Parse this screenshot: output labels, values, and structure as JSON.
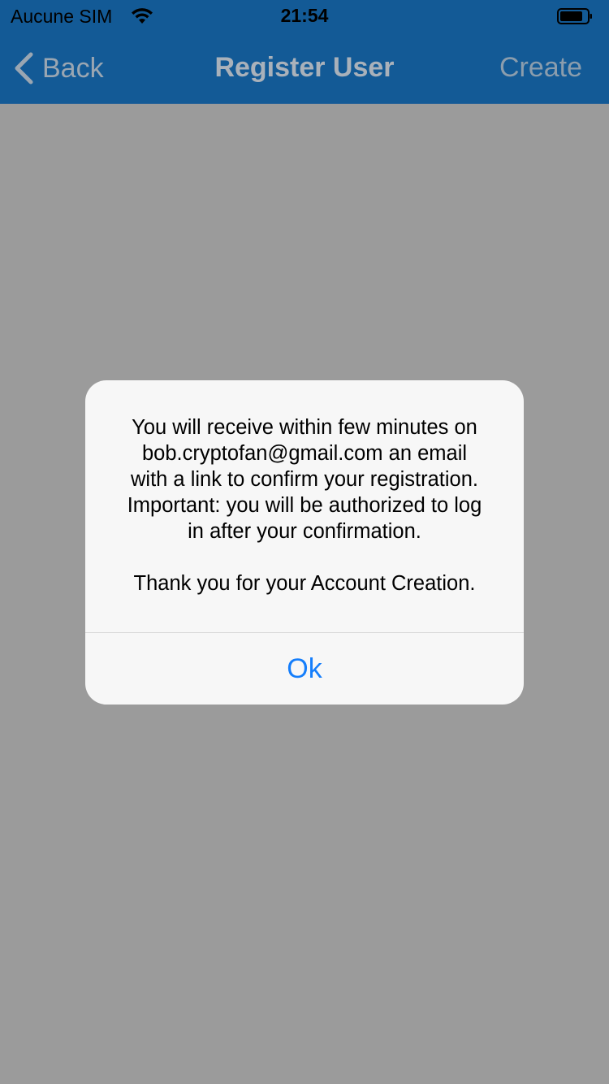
{
  "status_bar": {
    "carrier": "Aucune SIM",
    "time": "21:54",
    "wifi_icon": "wifi-icon",
    "battery_icon": "battery-icon"
  },
  "nav_bar": {
    "back_label": "Back",
    "title": "Register User",
    "create_label": "Create",
    "back_icon": "chevron-left-icon"
  },
  "alert": {
    "message_lines": [
      "You will receive within few minutes on",
      "bob.cryptofan@gmail.com an email",
      "with a link to confirm your registration.",
      "Important: you will be authorized to log",
      "in after your confirmation."
    ],
    "thanks": "Thank you for your Account Creation.",
    "ok_label": "Ok"
  },
  "colors": {
    "nav_background": "#135a96",
    "dim_background": "#9b9b9b",
    "alert_background": "#f7f7f7",
    "ok_tint": "#157efb"
  }
}
